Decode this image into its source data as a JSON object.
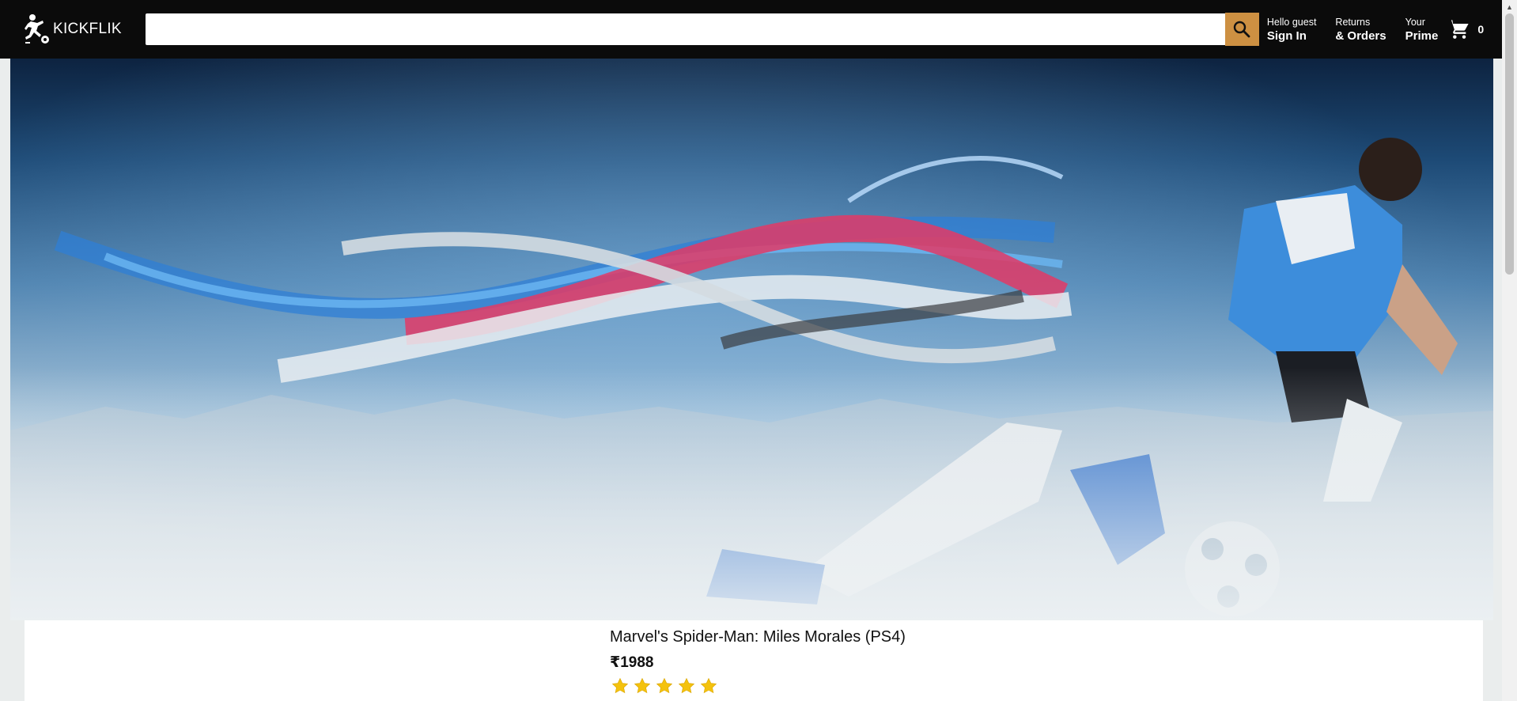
{
  "header": {
    "logo_text": "KICKFLIK",
    "search": {
      "value": "",
      "placeholder": ""
    },
    "nav": [
      {
        "line1": "Hello guest",
        "line2": "Sign In"
      },
      {
        "line1": "Returns",
        "line2": "& Orders"
      },
      {
        "line1": "Your",
        "line2": "Prime"
      }
    ],
    "basket_count": "0"
  },
  "product": {
    "title": "Marvel's Spider-Man: Miles Morales (PS4)",
    "price_symbol": "₹",
    "price": "1988",
    "rating": 5
  },
  "colors": {
    "header_bg": "#0b0b0b",
    "search_button": "#cd9042",
    "star": "#f4c20d"
  },
  "icons": [
    "logo-player-icon",
    "search-icon",
    "cart-icon",
    "star-icon"
  ]
}
